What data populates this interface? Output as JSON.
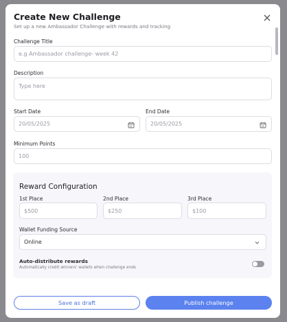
{
  "modal": {
    "title": "Create New Challenge",
    "subtitle": "Set up a new Ambassador Challenge with rewards and tracking"
  },
  "fields": {
    "challenge_title_label": "Challenge Title",
    "challenge_title_placeholder": "e.g Ambassador challenge- week 42",
    "description_label": "Description",
    "description_placeholder": "Type here",
    "start_date_label": "Start Date",
    "start_date_value": "20/05/2025",
    "end_date_label": "End Date",
    "end_date_value": "20/05/2025",
    "min_points_label": "Minimum Points",
    "min_points_placeholder": "100"
  },
  "reward": {
    "title": "Reward Configuration",
    "first_label": "1st Place",
    "first_placeholder": "$500",
    "second_label": "2nd Place",
    "second_placeholder": "$250",
    "third_label": "3rd Place",
    "third_placeholder": "$100",
    "wallet_label": "Wallet Funding Source",
    "wallet_value": "Online",
    "auto_label": "Auto-distribute rewards",
    "auto_desc": "Automatically credit winners' wallets when challenge ends",
    "auto_enabled": false
  },
  "buttons": {
    "draft": "Save as draft",
    "publish": "Publish challenge"
  },
  "colors": {
    "accent": "#5b82ee",
    "overlay": "#8a8a8e",
    "reward_bg": "#f7f6fb"
  },
  "icons": [
    "close-icon",
    "calendar-icon",
    "chevron-down-icon"
  ]
}
